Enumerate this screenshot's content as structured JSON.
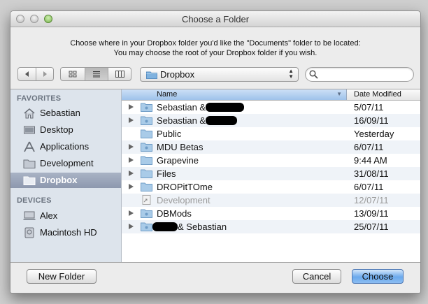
{
  "window": {
    "title": "Choose a Folder"
  },
  "prompt": {
    "line1": "Choose where in your Dropbox folder you'd like the \"Documents\" folder to be located:",
    "line2": "You may choose the root of your Dropbox folder if you wish."
  },
  "toolbar": {
    "back_icon": "back-arrow-icon",
    "forward_icon": "forward-arrow-icon",
    "views": [
      "icon-view",
      "list-view",
      "column-view"
    ],
    "active_view": "list-view",
    "location": "Dropbox",
    "search_placeholder": ""
  },
  "sidebar": {
    "favorites_header": "FAVORITES",
    "favorites": [
      {
        "label": "Sebastian",
        "icon": "home-icon"
      },
      {
        "label": "Desktop",
        "icon": "desktop-icon"
      },
      {
        "label": "Applications",
        "icon": "applications-icon"
      },
      {
        "label": "Development",
        "icon": "folder-icon"
      },
      {
        "label": "Dropbox",
        "icon": "folder-icon",
        "selected": true
      }
    ],
    "devices_header": "DEVICES",
    "devices": [
      {
        "label": "Alex",
        "icon": "computer-icon"
      },
      {
        "label": "Macintosh HD",
        "icon": "hard-drive-icon"
      }
    ]
  },
  "list": {
    "columns": {
      "name": "Name",
      "date": "Date Modified"
    },
    "rows": [
      {
        "name": "Sebastian &",
        "redacted_suffix": true,
        "date": "5/07/11",
        "shared": true
      },
      {
        "name": "Sebastian &",
        "redacted_suffix": true,
        "date": "16/09/11",
        "shared": true
      },
      {
        "name": "Public",
        "date": "Yesterday"
      },
      {
        "name": "MDU Betas",
        "date": "6/07/11",
        "shared": true
      },
      {
        "name": "Grapevine",
        "date": "9:44 AM"
      },
      {
        "name": "Files",
        "date": "31/08/11"
      },
      {
        "name": "DROPitTOme",
        "date": "6/07/11"
      },
      {
        "name": "Development",
        "date": "12/07/11",
        "alias": true,
        "disabled": true
      },
      {
        "name": "DBMods",
        "date": "13/09/11",
        "shared": true
      },
      {
        "name": "& Sebastian",
        "redacted_prefix": true,
        "date": "25/07/11",
        "shared": true
      }
    ]
  },
  "buttons": {
    "new_folder": "New Folder",
    "cancel": "Cancel",
    "choose": "Choose"
  },
  "colors": {
    "sidebar_bg": "#dde4ec",
    "selection": "#8d98ae",
    "accent": "#6aa9ec"
  }
}
